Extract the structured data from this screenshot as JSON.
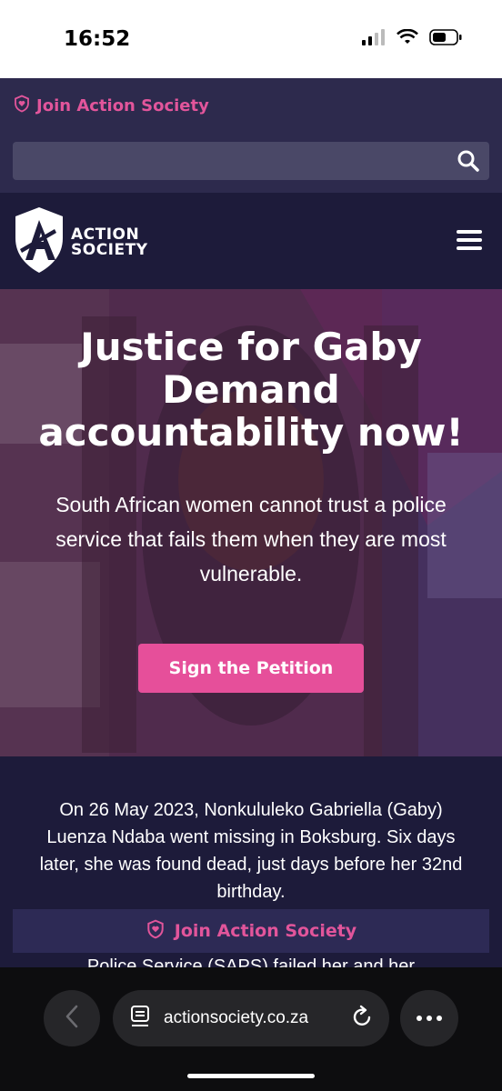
{
  "status": {
    "time": "16:52"
  },
  "topbar": {
    "join_label": "Join Action Society",
    "search_placeholder": ""
  },
  "navbar": {
    "logo_line1": "ACTION",
    "logo_line2": "SOCIETY"
  },
  "hero": {
    "title_line1": "Justice for Gaby",
    "title_line2": "Demand",
    "title_line3": "accountability now!",
    "subtitle": "South African women cannot trust a police service that fails them when they are most vulnerable.",
    "cta_label": "Sign the Petition"
  },
  "content": {
    "story": "On 26 May 2023, Nonkululeko Gabriella (Gaby) Luenza Ndaba went missing in Boksburg. Six days later, she was found dead, just days before her 32nd birthday.",
    "sticky_join_label": "Join Action Society",
    "story_continued": "Police Service (SAPS) failed her and her"
  },
  "browser": {
    "url": "actionsociety.co.za"
  },
  "colors": {
    "accent": "#e64f9a",
    "navy": "#1d1b3a",
    "topbar": "#2d2a4d"
  }
}
